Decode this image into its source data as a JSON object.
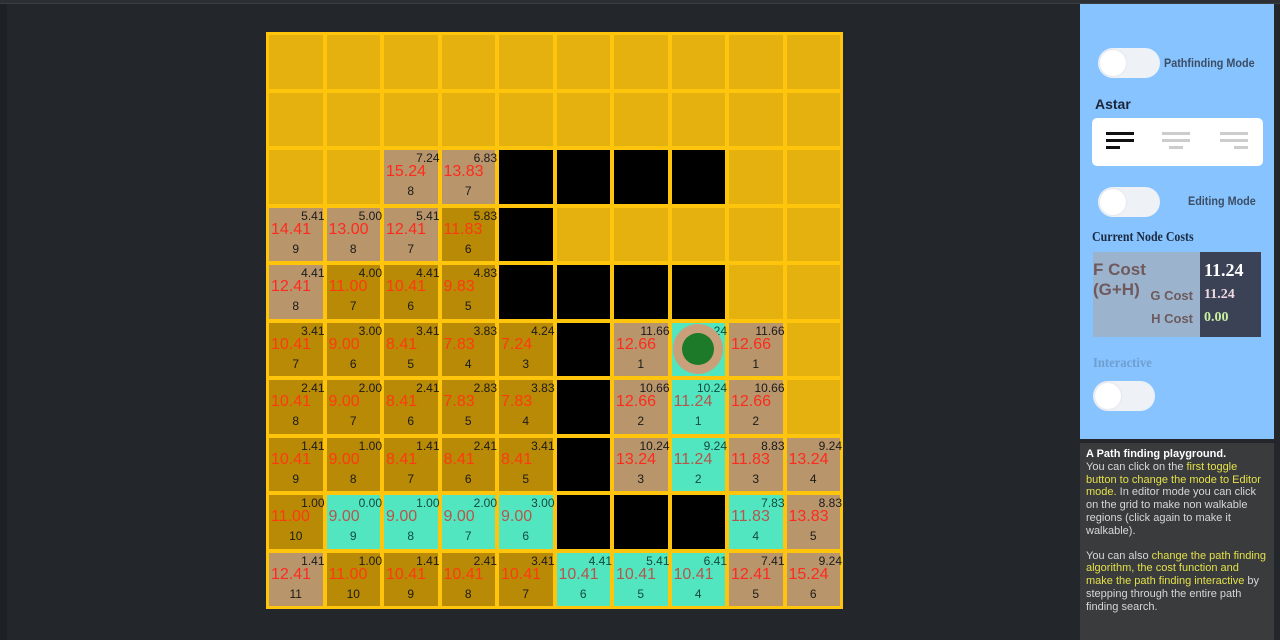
{
  "grid": {
    "rows": 10,
    "cols": 10,
    "colors": {
      "empty": "#e5b10f",
      "wall": "#000000",
      "open": "#b8956a",
      "closed": "#b88a06",
      "path": "#52e6c0",
      "border": "#ffc40c"
    },
    "cells": [
      [
        "E",
        "E",
        "E",
        "E",
        "E",
        "E",
        "E",
        "E",
        "E",
        "E"
      ],
      [
        "E",
        "E",
        "E",
        "E",
        "E",
        "E",
        "E",
        "E",
        "E",
        "E"
      ],
      [
        "E",
        "E",
        {
          "t": "O",
          "h": "7.24",
          "f": "15.24",
          "g": "8"
        },
        {
          "t": "O",
          "h": "6.83",
          "f": "13.83",
          "g": "7"
        },
        "W",
        "W",
        "W",
        "W",
        "E",
        "E"
      ],
      [
        {
          "t": "O",
          "h": "5.41",
          "f": "14.41",
          "g": "9"
        },
        {
          "t": "O",
          "h": "5.00",
          "f": "13.00",
          "g": "8"
        },
        {
          "t": "O",
          "h": "5.41",
          "f": "12.41",
          "g": "7"
        },
        {
          "t": "C",
          "h": "5.83",
          "f": "11.83",
          "g": "6"
        },
        "W",
        "E",
        "E",
        "E",
        "E",
        "E"
      ],
      [
        {
          "t": "O",
          "h": "4.41",
          "f": "12.41",
          "g": "8"
        },
        {
          "t": "C",
          "h": "4.00",
          "f": "11.00",
          "g": "7"
        },
        {
          "t": "C",
          "h": "4.41",
          "f": "10.41",
          "g": "6"
        },
        {
          "t": "C",
          "h": "4.83",
          "f": "9.83",
          "g": "5"
        },
        "W",
        "W",
        "W",
        "W",
        "E",
        "E"
      ],
      [
        {
          "t": "C",
          "h": "3.41",
          "f": "10.41",
          "g": "7"
        },
        {
          "t": "C",
          "h": "3.00",
          "f": "9.00",
          "g": "6"
        },
        {
          "t": "C",
          "h": "3.41",
          "f": "8.41",
          "g": "5"
        },
        {
          "t": "C",
          "h": "3.83",
          "f": "7.83",
          "g": "4"
        },
        {
          "t": "C",
          "h": "4.24",
          "f": "7.24",
          "g": "3"
        },
        "W",
        {
          "t": "O",
          "h": "11.66",
          "f": "12.66",
          "g": "1"
        },
        {
          "t": "P",
          "h": "11.24",
          "f": "",
          "g": "",
          "marker": true
        },
        {
          "t": "O",
          "h": "11.66",
          "f": "12.66",
          "g": "1"
        },
        "E"
      ],
      [
        {
          "t": "C",
          "h": "2.41",
          "f": "10.41",
          "g": "8"
        },
        {
          "t": "C",
          "h": "2.00",
          "f": "9.00",
          "g": "7"
        },
        {
          "t": "C",
          "h": "2.41",
          "f": "8.41",
          "g": "6"
        },
        {
          "t": "C",
          "h": "2.83",
          "f": "7.83",
          "g": "5"
        },
        {
          "t": "C",
          "h": "3.83",
          "f": "7.83",
          "g": "4"
        },
        "W",
        {
          "t": "O",
          "h": "10.66",
          "f": "12.66",
          "g": "2"
        },
        {
          "t": "P",
          "h": "10.24",
          "f": "11.24",
          "g": "1"
        },
        {
          "t": "O",
          "h": "10.66",
          "f": "12.66",
          "g": "2"
        },
        "E"
      ],
      [
        {
          "t": "C",
          "h": "1.41",
          "f": "10.41",
          "g": "9"
        },
        {
          "t": "C",
          "h": "1.00",
          "f": "9.00",
          "g": "8"
        },
        {
          "t": "C",
          "h": "1.41",
          "f": "8.41",
          "g": "7"
        },
        {
          "t": "C",
          "h": "2.41",
          "f": "8.41",
          "g": "6"
        },
        {
          "t": "C",
          "h": "3.41",
          "f": "8.41",
          "g": "5"
        },
        "W",
        {
          "t": "O",
          "h": "10.24",
          "f": "13.24",
          "g": "3"
        },
        {
          "t": "P",
          "h": "9.24",
          "f": "11.24",
          "g": "2"
        },
        {
          "t": "O",
          "h": "8.83",
          "f": "11.83",
          "g": "3"
        },
        {
          "t": "O",
          "h": "9.24",
          "f": "13.24",
          "g": "4"
        }
      ],
      [
        {
          "t": "C",
          "h": "1.00",
          "f": "11.00",
          "g": "10"
        },
        {
          "t": "P",
          "h": "0.00",
          "f": "9.00",
          "g": "9"
        },
        {
          "t": "P",
          "h": "1.00",
          "f": "9.00",
          "g": "8"
        },
        {
          "t": "P",
          "h": "2.00",
          "f": "9.00",
          "g": "7"
        },
        {
          "t": "P",
          "h": "3.00",
          "f": "9.00",
          "g": "6"
        },
        "W",
        "W",
        "W",
        {
          "t": "P",
          "h": "7.83",
          "f": "11.83",
          "g": "4"
        },
        {
          "t": "O",
          "h": "8.83",
          "f": "13.83",
          "g": "5"
        }
      ],
      [
        {
          "t": "O",
          "h": "1.41",
          "f": "12.41",
          "g": "11"
        },
        {
          "t": "C",
          "h": "1.00",
          "f": "11.00",
          "g": "10"
        },
        {
          "t": "C",
          "h": "1.41",
          "f": "10.41",
          "g": "9"
        },
        {
          "t": "C",
          "h": "2.41",
          "f": "10.41",
          "g": "8"
        },
        {
          "t": "C",
          "h": "3.41",
          "f": "10.41",
          "g": "7"
        },
        {
          "t": "P",
          "h": "4.41",
          "f": "10.41",
          "g": "6"
        },
        {
          "t": "P",
          "h": "5.41",
          "f": "10.41",
          "g": "5"
        },
        {
          "t": "P",
          "h": "6.41",
          "f": "10.41",
          "g": "4"
        },
        {
          "t": "O",
          "h": "7.41",
          "f": "12.41",
          "g": "5"
        },
        {
          "t": "O",
          "h": "9.24",
          "f": "15.24",
          "g": "6"
        }
      ]
    ]
  },
  "panel": {
    "pathfinding_toggle_label": "Pathfinding Mode",
    "pathfinding_toggle_on": false,
    "algorithm_title": "Astar",
    "algorithm_options": [
      "algorithm-option-1",
      "algorithm-option-2",
      "algorithm-option-3"
    ],
    "selected_algorithm_index": 0,
    "editing_toggle_label": "Editing Mode",
    "editing_toggle_on": false,
    "costs_title": "Current Node Costs",
    "f_cost_label": "F Cost (G+H)",
    "f_cost_value": "11.24",
    "g_cost_label": "G Cost",
    "g_cost_value": "11.24",
    "h_cost_label": "H Cost",
    "h_cost_value": "0.00",
    "interactive_label": "Interactive",
    "interactive_toggle_on": false,
    "colors": {
      "background": "#87c4ff",
      "f_value": "#ffffff",
      "g_value": "#f0d8e0",
      "h_value": "#c8f0a0"
    }
  },
  "info": {
    "title": "A Path finding playground.",
    "p1_a": "You can click on the ",
    "p1_hl": "first toggle button to change  the mode to Editor mode.",
    "p1_b": " In editor mode you can click on the grid to make non walkable regions (click again to make it walkable).",
    "p2_a": "You can also ",
    "p2_hl": "change the path finding algorithm, the cost function and make the path finding interactive",
    "p2_b": " by stepping through the entire path finding search."
  }
}
